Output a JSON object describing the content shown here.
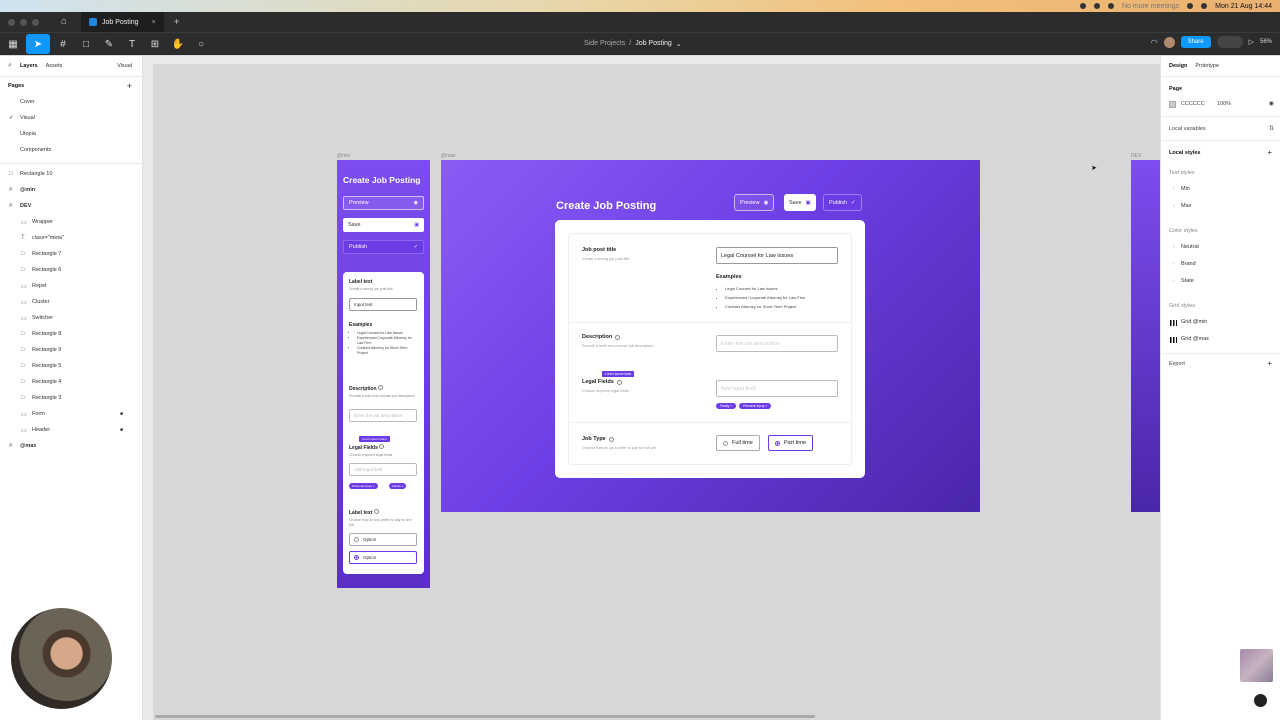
{
  "menubar": {
    "status_text": "No more meetings",
    "clock": "Mon 21 Aug 14:44"
  },
  "tabbar": {
    "doc_tab": "Job Posting",
    "close": "×",
    "new_tab": "+"
  },
  "toolbar": {
    "breadcrumb_project": "Side Projects",
    "breadcrumb_sep": "/",
    "breadcrumb_file": "Job Posting",
    "share_label": "Share",
    "zoom": "56%"
  },
  "left_panel": {
    "tabs": [
      "Layers",
      "Assets"
    ],
    "page_dropdown": "Visual",
    "pages_heading": "Pages",
    "pages": [
      {
        "label": "Cover",
        "active": false
      },
      {
        "label": "Visual",
        "active": true
      },
      {
        "label": "Utopia",
        "active": false
      },
      {
        "label": "Components",
        "active": false
      }
    ],
    "layers": [
      {
        "label": "Rectangle 10",
        "level": 1
      },
      {
        "label": "@min",
        "level": 1
      },
      {
        "label": "DEV",
        "level": 1
      },
      {
        "label": "Wrapper",
        "level": 2
      },
      {
        "label": "class=\"meta\"",
        "level": 2
      },
      {
        "label": "Rectangle 7",
        "level": 2
      },
      {
        "label": "Rectangle 6",
        "level": 2
      },
      {
        "label": "Repel",
        "level": 2
      },
      {
        "label": "Cluster",
        "level": 2
      },
      {
        "label": "Switcher",
        "level": 2
      },
      {
        "label": "Rectangle 8",
        "level": 2
      },
      {
        "label": "Rectangle 9",
        "level": 2
      },
      {
        "label": "Rectangle 5",
        "level": 2
      },
      {
        "label": "Rectangle 4",
        "level": 2
      },
      {
        "label": "Rectangle 3",
        "level": 2
      },
      {
        "label": "Form",
        "level": 2
      },
      {
        "label": "Header",
        "level": 2
      },
      {
        "label": "@max",
        "level": 1
      }
    ]
  },
  "canvas": {
    "frame_labels": {
      "min": "@min",
      "max": "@max",
      "dev": "DEV"
    },
    "min_frame": {
      "title": "Create Job Posting",
      "preview": "Preview",
      "save": "Save",
      "publish": "Publish",
      "label_text": "Label text",
      "label_sub": "Create a strong job post title",
      "input_text": "Input text",
      "examples": "Examples",
      "example_items": [
        "Legal Counsel for Law Issues",
        "Experienced Corporate Attorney for Law Firm",
        "Contract Attorney for Short-Term Project"
      ],
      "description": "Description",
      "description_sub": "Provide a brief and concise job description",
      "description_ph": "Enter the job description",
      "tooltip": "Lorem ipsum dolor",
      "legal_fields": "Legal Fields",
      "legal_sub": "Choose required legal fields",
      "legal_ph": "Add legal field",
      "tags": [
        "Personal Injury ×",
        "Family ×"
      ],
      "label_text_2": "Label text",
      "label_sub_2": "Choose how do you prefer to pay for the job",
      "options": [
        "Option",
        "Option"
      ]
    },
    "max_frame": {
      "title": "Create Job Posting",
      "preview": "Preview",
      "save": "Save",
      "publish": "Publish",
      "job_post_title": "Job post title",
      "job_post_sub": "Create a strong job post title",
      "job_post_value": "Legal Counsel for Law Issues",
      "examples": "Examples",
      "example_items": [
        "Legal Counsel for Law Issues",
        "Experienced Corporate Attorney for Law Firm",
        "Contract Attorney for Short-Term Project"
      ],
      "description": "Description",
      "description_sub": "Provide a brief and concise job description",
      "description_ph": "Enter the job description",
      "legal_fields": "Legal Fields",
      "legal_sub": "Choose required legal fields",
      "legal_ph": "Add legal field",
      "tooltip": "Lorem ipsum dolor",
      "tags": [
        "Family ×",
        "Personal Injury ×"
      ],
      "job_type": "Job Type",
      "job_type_sub": "Choose how do you prefer to pay for the job",
      "full_time": "Full time",
      "part_time": "Part time"
    }
  },
  "right_panel": {
    "tabs": [
      "Design",
      "Prototype"
    ],
    "page_heading": "Page",
    "page_color": "CCCCCC",
    "page_opacity": "100%",
    "local_variables": "Local variables",
    "local_styles": "Local styles",
    "text_styles": "Text styles",
    "text_style_items": [
      "Min",
      "Max"
    ],
    "color_styles": "Color styles",
    "color_style_items": [
      "Neutral",
      "Brand",
      "State"
    ],
    "grid_styles": "Grid styles",
    "grid_style_items": [
      "Grid @min",
      "Grid @max"
    ],
    "export": "Export"
  },
  "colors": {
    "brand_purple": "#6b3be6",
    "figma_blue": "#0d99ff"
  }
}
